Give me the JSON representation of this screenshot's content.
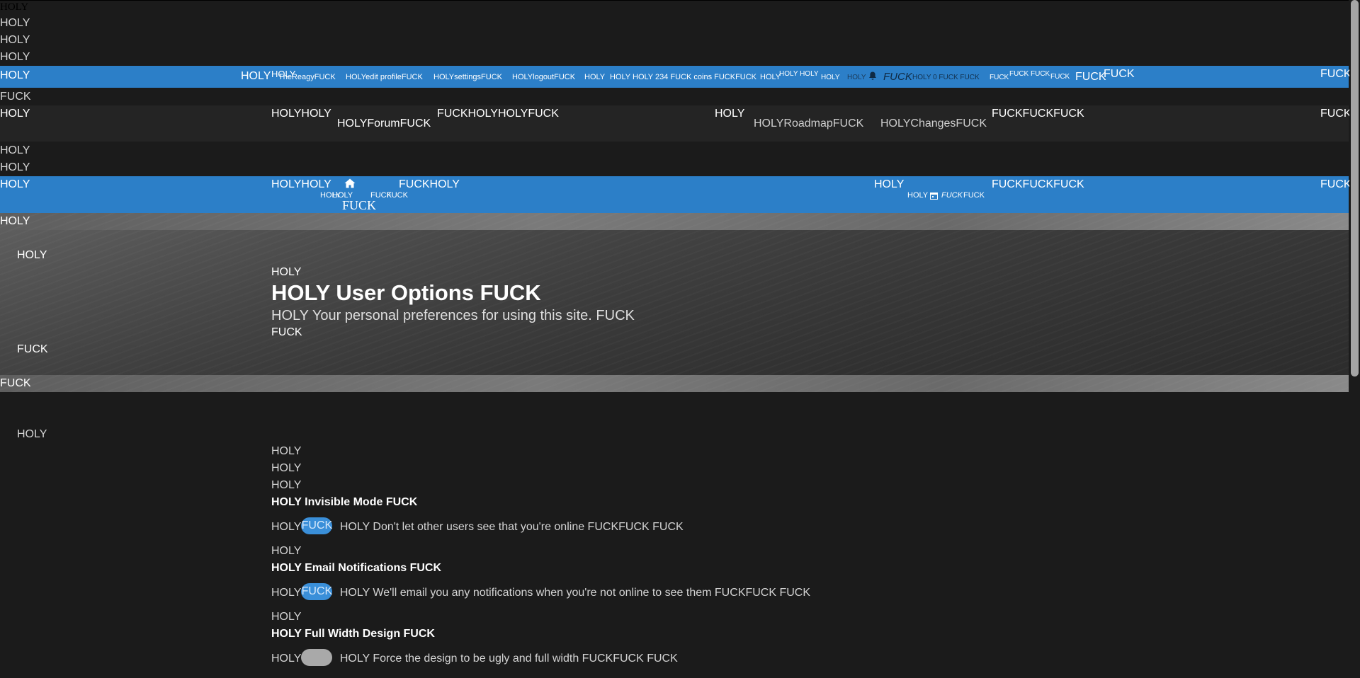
{
  "top_lines": [
    "HOLY",
    "HOLY",
    "HOLY",
    "HOLY"
  ],
  "accountbar": {
    "left": "HOLY",
    "brand": "HOLY",
    "brand_small": "HOLY",
    "username": "TheReagyFUCK",
    "edit_profile": "HOLYedit profileFUCK",
    "settings": "HOLYsettingsFUCK",
    "logout": "HOLYlogoutFUCK",
    "sep1": "HOLY",
    "coins": "HOLY HOLY 234 FUCK coins FUCKFUCK",
    "n1": "HOLY",
    "n1_up": "HOLY HOLY",
    "n2": "HOLY",
    "n3": "HOLY",
    "bell_text": "FUCK",
    "notifications": "HOLY 0 FUCK FUCK",
    "n4": "FUCK",
    "n4_up": "FUCK FUCK",
    "n5": "FUCK",
    "big_fuck1": "FUCK",
    "big_fuck2": "FUCK",
    "right": "FUCK"
  },
  "after_accountbar": "FUCK",
  "mainnav": {
    "left": "HOLY",
    "logo": "HOLYHOLY",
    "forum": "HOLYForumFUCK",
    "mid": "FUCKHOLYHOLYFUCK",
    "mid2": "HOLY",
    "roadmap": "HOLYRoadmapFUCK",
    "changes": "HOLYChangesFUCK",
    "endgroup": "FUCKFUCKFUCK",
    "right": "FUCK"
  },
  "mid_lines": [
    "HOLY",
    "HOLY"
  ],
  "subnav": {
    "left": "HOLY",
    "logo": "HOLYHOLY",
    "home_left": "HOLY",
    "home_label": "HOLY",
    "home_right": "FUCK",
    "home_right2": "FUCK",
    "home_big": "FUCK",
    "after_home": "FUCKHOLY",
    "mid": "HOLY",
    "cal_left": "HOLY",
    "cal_em": "FUCK",
    "cal_right": "FUCK",
    "endgroup": "FUCKFUCKFUCK",
    "right": "FUCK"
  },
  "hero": {
    "top_strip": "HOLY",
    "side_top": "HOLY",
    "pre": "HOLY",
    "title": "HOLY User Options FUCK",
    "subtitle": "HOLY Your personal preferences for using this site. FUCK",
    "post": "FUCK",
    "side_bottom": "FUCK",
    "bottom_strip": "FUCK"
  },
  "content": {
    "side": "HOLY",
    "lines": [
      "HOLY",
      "HOLY",
      "HOLY"
    ],
    "options": [
      {
        "title": "HOLY Invisible Mode FUCK",
        "prefix": "HOLY",
        "toggle_label": "FUCK",
        "enabled": true,
        "description": "HOLY Don't let other users see that you're online FUCKFUCK FUCK",
        "after": "HOLY"
      },
      {
        "title": "HOLY Email Notifications FUCK",
        "prefix": "HOLY",
        "toggle_label": "FUCK",
        "enabled": true,
        "description": "HOLY We'll email you any notifications when you're not online to see them FUCKFUCK FUCK",
        "after": "HOLY"
      },
      {
        "title": "HOLY Full Width Design FUCK",
        "prefix": "HOLY",
        "toggle_label": "",
        "enabled": false,
        "description": "HOLY Force the design to be ugly and full width FUCKFUCK FUCK"
      }
    ]
  },
  "colors": {
    "background": "#1b1b1b",
    "nav_blue": "#2c7fc8",
    "toggle_on": "#3a8fd9",
    "toggle_off": "#a9a9a9"
  }
}
